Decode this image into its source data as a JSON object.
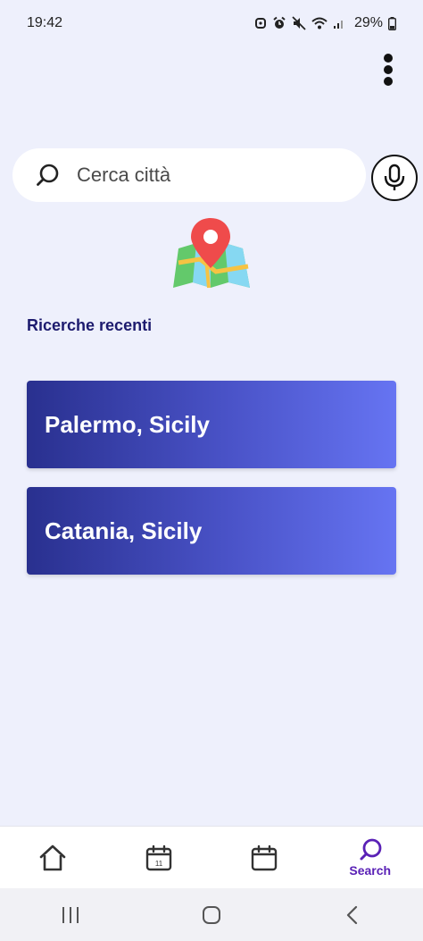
{
  "status_bar": {
    "time": "19:42",
    "battery": "29%",
    "icons": [
      "notification-icon",
      "alarm-icon",
      "mute-icon",
      "wifi-icon",
      "signal-icon",
      "battery-icon"
    ]
  },
  "search": {
    "placeholder": "Cerca città",
    "value": ""
  },
  "recent": {
    "title": "Ricerche recenti",
    "items": [
      {
        "label": "Palermo, Sicily"
      },
      {
        "label": "Catania, Sicily"
      }
    ]
  },
  "bottom_nav": {
    "items": [
      {
        "icon": "home-icon",
        "label": ""
      },
      {
        "icon": "calendar-day-icon",
        "label": "",
        "badge": "11"
      },
      {
        "icon": "calendar-icon",
        "label": ""
      },
      {
        "icon": "search-icon",
        "label": "Search",
        "active": true
      }
    ]
  },
  "colors": {
    "background": "#eef0fc",
    "accent": "#5a21b6",
    "title": "#1d1b6e",
    "card_gradient_start": "#29308f",
    "card_gradient_end": "#6674f2"
  }
}
